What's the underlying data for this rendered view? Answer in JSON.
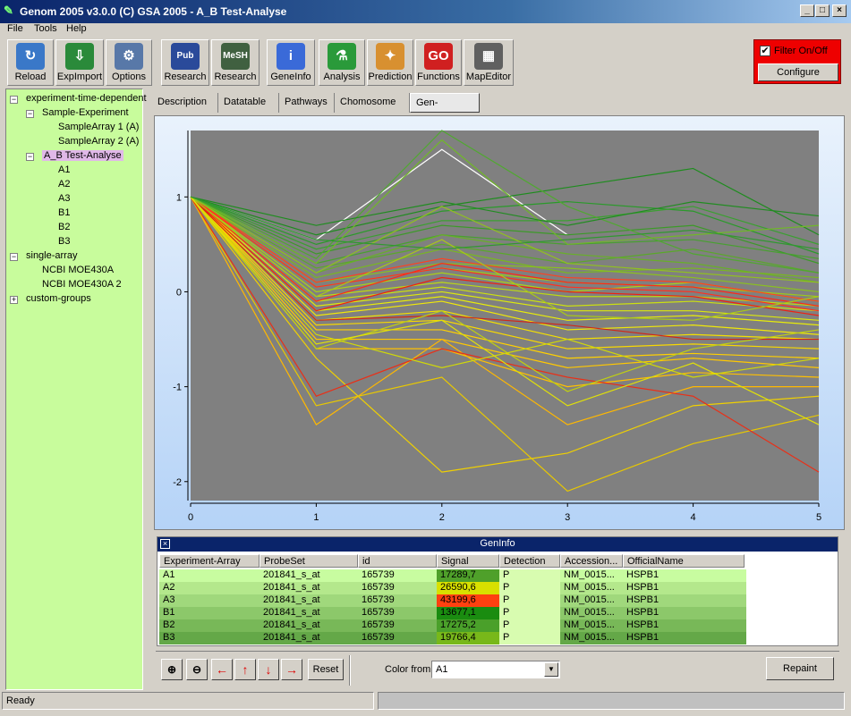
{
  "window": {
    "title": "Genom 2005 v3.0.0 (C) GSA 2005 - A_B Test-Analyse"
  },
  "menu": [
    "File",
    "Tools",
    "Help"
  ],
  "toolbar": [
    {
      "label": "Reload",
      "icon": "reload-icon",
      "color": "#3a78c8"
    },
    {
      "label": "ExpImport",
      "icon": "import-icon",
      "color": "#2a8a3a"
    },
    {
      "label": "Options",
      "icon": "options-icon",
      "color": "#5878a8"
    },
    {
      "label": "Research",
      "icon": "pubmed-icon",
      "color": "#2a4a9a"
    },
    {
      "label": "Research",
      "icon": "mesh-icon",
      "color": "#406040"
    },
    {
      "label": "GeneInfo",
      "icon": "info-icon",
      "color": "#3a6ad8"
    },
    {
      "label": "Analysis",
      "icon": "flask-icon",
      "color": "#2a9a3a"
    },
    {
      "label": "Prediction",
      "icon": "wand-icon",
      "color": "#d89030"
    },
    {
      "label": "Functions",
      "icon": "go-icon",
      "color": "#d02020"
    },
    {
      "label": "MapEditor",
      "icon": "map-icon",
      "color": "#606060"
    }
  ],
  "filter": {
    "label": "Filter On/Off",
    "configure": "Configure",
    "checked": true
  },
  "tree": [
    {
      "label": "experiment-time-dependent",
      "level": 0,
      "toggle": "−"
    },
    {
      "label": "Sample-Experiment",
      "level": 1,
      "toggle": "−"
    },
    {
      "label": "SampleArray 1 (A)",
      "level": 2,
      "toggle": ""
    },
    {
      "label": "SampleArray 2 (A)",
      "level": 2,
      "toggle": ""
    },
    {
      "label": "A_B Test-Analyse",
      "level": 1,
      "toggle": "−",
      "selected": true
    },
    {
      "label": "A1",
      "level": 2,
      "toggle": ""
    },
    {
      "label": "A2",
      "level": 2,
      "toggle": ""
    },
    {
      "label": "A3",
      "level": 2,
      "toggle": ""
    },
    {
      "label": "B1",
      "level": 2,
      "toggle": ""
    },
    {
      "label": "B2",
      "level": 2,
      "toggle": ""
    },
    {
      "label": "B3",
      "level": 2,
      "toggle": ""
    },
    {
      "label": "single-array",
      "level": 0,
      "toggle": "−"
    },
    {
      "label": "NCBI MOE430A",
      "level": 1,
      "toggle": ""
    },
    {
      "label": "NCBI MOE430A 2",
      "level": 1,
      "toggle": ""
    },
    {
      "label": "custom-groups",
      "level": 0,
      "toggle": "+"
    }
  ],
  "tabs": [
    "Description",
    "Datatable",
    "Pathways",
    "Chomosome",
    "Gen-Process"
  ],
  "active_tab": "Gen-Process",
  "chart_data": {
    "type": "line",
    "x": [
      0,
      1,
      2,
      3,
      4,
      5
    ],
    "xticks": [
      "0",
      "1",
      "2",
      "3",
      "4",
      "5"
    ],
    "yticks": [
      "1",
      "0",
      "-1",
      "-2"
    ],
    "ylim": [
      -2.2,
      1.7
    ],
    "xlim": [
      0,
      5
    ],
    "background": "#808080",
    "series_note": "",
    "series": [
      {
        "color": "#ffffff",
        "values": [
          1,
          0.55,
          1.5,
          0.6,
          null,
          null
        ]
      },
      {
        "color": "#1e8c1e",
        "values": [
          1,
          0.6,
          0.9,
          1.1,
          1.3,
          0.6
        ]
      },
      {
        "color": "#2a9a2a",
        "values": [
          1,
          0.5,
          0.85,
          0.95,
          0.85,
          0.4
        ]
      },
      {
        "color": "#3aa030",
        "values": [
          1,
          0.45,
          0.75,
          0.75,
          0.9,
          0.5
        ]
      },
      {
        "color": "#3c9a28",
        "values": [
          1,
          0.4,
          0.7,
          0.6,
          0.7,
          0.3
        ]
      },
      {
        "color": "#48a030",
        "values": [
          1,
          0.3,
          0.6,
          0.5,
          0.55,
          0.35
        ]
      },
      {
        "color": "#5aa82a",
        "values": [
          1,
          0.25,
          0.5,
          0.3,
          0.45,
          0.2
        ]
      },
      {
        "color": "#68b028",
        "values": [
          1,
          0.2,
          0.6,
          0.4,
          0.3,
          0.1
        ]
      },
      {
        "color": "#78b820",
        "values": [
          1,
          0.15,
          0.45,
          0.2,
          0.25,
          0.15
        ]
      },
      {
        "color": "#8ac020",
        "values": [
          1,
          0.1,
          0.3,
          0.25,
          0.15,
          0.0
        ]
      },
      {
        "color": "#9cc81c",
        "values": [
          1,
          0.05,
          0.25,
          0.1,
          0.05,
          -0.05
        ]
      },
      {
        "color": "#aad018",
        "values": [
          1,
          0.0,
          0.2,
          0.0,
          0.1,
          -0.1
        ]
      },
      {
        "color": "#bcd814",
        "values": [
          1,
          -0.05,
          0.1,
          -0.05,
          -0.05,
          -0.15
        ]
      },
      {
        "color": "#cce010",
        "values": [
          1,
          -0.1,
          0.05,
          -0.15,
          -0.1,
          -0.2
        ]
      },
      {
        "color": "#dce80c",
        "values": [
          1,
          -0.15,
          0.0,
          -0.2,
          -0.2,
          -0.3
        ]
      },
      {
        "color": "#e8ec08",
        "values": [
          1,
          -0.2,
          -0.05,
          -0.3,
          -0.25,
          -0.35
        ]
      },
      {
        "color": "#f0e808",
        "values": [
          1,
          -0.25,
          -0.1,
          -0.4,
          -0.35,
          -0.45
        ]
      },
      {
        "color": "#f4e000",
        "values": [
          1,
          -0.3,
          -0.2,
          -0.5,
          -0.45,
          -0.5
        ]
      },
      {
        "color": "#f8d800",
        "values": [
          1,
          -0.35,
          -0.3,
          -0.6,
          -0.55,
          -0.6
        ]
      },
      {
        "color": "#ffd000",
        "values": [
          1,
          -0.4,
          -0.4,
          -0.7,
          -0.65,
          -0.7
        ]
      },
      {
        "color": "#ffc800",
        "values": [
          1,
          -0.5,
          -0.5,
          -0.8,
          -0.7,
          -0.8
        ]
      },
      {
        "color": "#ffc000",
        "values": [
          1,
          -0.6,
          -0.6,
          -1.0,
          -0.85,
          -0.9
        ]
      },
      {
        "color": "#ffb800",
        "values": [
          1,
          -1.4,
          -0.5,
          -1.4,
          -1.0,
          -1.0
        ]
      },
      {
        "color": "#f0d000",
        "values": [
          1,
          -0.7,
          -1.9,
          -1.7,
          -1.2,
          -1.1
        ]
      },
      {
        "color": "#e8c800",
        "values": [
          1,
          -1.2,
          -0.9,
          -2.1,
          -1.6,
          -1.3
        ]
      },
      {
        "color": "#ff3020",
        "values": [
          1,
          0.05,
          0.25,
          0.05,
          0.0,
          -0.2
        ]
      },
      {
        "color": "#ff2818",
        "values": [
          1,
          -0.1,
          0.3,
          0.1,
          0.05,
          -0.15
        ]
      },
      {
        "color": "#f02010",
        "values": [
          1,
          -0.2,
          0.15,
          0.0,
          -0.05,
          -0.25
        ]
      },
      {
        "color": "#ff4020",
        "values": [
          1,
          0.1,
          0.35,
          0.15,
          0.1,
          -0.1
        ]
      },
      {
        "color": "#e83018",
        "values": [
          1,
          -1.1,
          -0.6,
          -0.9,
          -1.1,
          -1.9
        ]
      },
      {
        "color": "#d02818",
        "values": [
          1,
          -0.3,
          -0.25,
          -0.35,
          -0.5,
          -0.5
        ]
      },
      {
        "color": "#50a830",
        "values": [
          1,
          0.35,
          1.7,
          0.9,
          0.4,
          0.2
        ]
      },
      {
        "color": "#70b828",
        "values": [
          1,
          0.3,
          1.6,
          0.5,
          0.6,
          0.7
        ]
      },
      {
        "color": "#90c020",
        "values": [
          1,
          0.2,
          0.9,
          0.3,
          0.2,
          0.1
        ]
      },
      {
        "color": "#a8c818",
        "values": [
          1,
          -0.05,
          0.55,
          -0.25,
          -0.3,
          -0.05
        ]
      },
      {
        "color": "#c0d010",
        "values": [
          1,
          -0.6,
          -0.2,
          -1.05,
          -0.6,
          -0.4
        ]
      },
      {
        "color": "#d0d808",
        "values": [
          1,
          -0.45,
          -0.8,
          -0.5,
          -0.9,
          -0.7
        ]
      },
      {
        "color": "#e0e008",
        "values": [
          1,
          -0.55,
          -0.3,
          -1.2,
          -0.75,
          -1.4
        ]
      },
      {
        "color": "#208c20",
        "values": [
          1,
          0.7,
          0.95,
          0.7,
          0.95,
          0.8
        ]
      },
      {
        "color": "#309830",
        "values": [
          1,
          0.55,
          0.45,
          0.55,
          0.65,
          0.45
        ]
      }
    ]
  },
  "geninfo": {
    "title": "GenInfo",
    "columns": [
      "Experiment-Array",
      "ProbeSet",
      "id",
      "Signal",
      "Detection",
      "Accession...",
      "OfficialName"
    ],
    "rows": [
      {
        "exp": "A1",
        "probe": "201841_s_at",
        "id": "165739",
        "signal": "17289,7",
        "det": "P",
        "acc": "NM_0015...",
        "name": "HSPB1",
        "bg": "#c8fca0",
        "sig": "#4fa02a"
      },
      {
        "exp": "A2",
        "probe": "201841_s_at",
        "id": "165739",
        "signal": "26590,6",
        "det": "P",
        "acc": "NM_0015...",
        "name": "HSPB1",
        "bg": "#b4e88c",
        "sig": "#d8e000"
      },
      {
        "exp": "A3",
        "probe": "201841_s_at",
        "id": "165739",
        "signal": "43199,6",
        "det": "P",
        "acc": "NM_0015...",
        "name": "HSPB1",
        "bg": "#a0d87c",
        "sig": "#ff4010"
      },
      {
        "exp": "B1",
        "probe": "201841_s_at",
        "id": "165739",
        "signal": "13677,1",
        "det": "P",
        "acc": "NM_0015...",
        "name": "HSPB1",
        "bg": "#8cc86a",
        "sig": "#1a8c10"
      },
      {
        "exp": "B2",
        "probe": "201841_s_at",
        "id": "165739",
        "signal": "17275,2",
        "det": "P",
        "acc": "NM_0015...",
        "name": "HSPB1",
        "bg": "#78b858",
        "sig": "#4aa02a"
      },
      {
        "exp": "B3",
        "probe": "201841_s_at",
        "id": "165739",
        "signal": "19766,4",
        "det": "P",
        "acc": "NM_0015...",
        "name": "HSPB1",
        "bg": "#64a848",
        "sig": "#78b81a"
      }
    ]
  },
  "controls": {
    "reset": "Reset",
    "color_from_label": "Color from",
    "color_from_value": "A1",
    "repaint": "Repaint"
  },
  "status": {
    "text": "Ready"
  }
}
